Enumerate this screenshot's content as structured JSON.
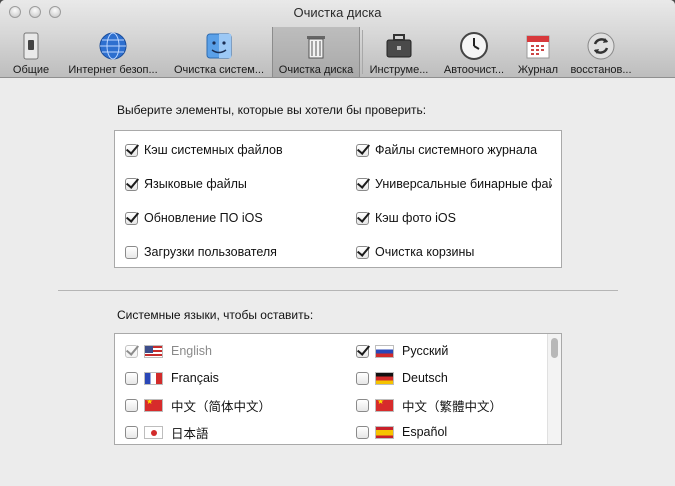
{
  "window": {
    "title": "Очистка диска"
  },
  "toolbar": {
    "items": [
      {
        "label": "Общие",
        "icon": "switch-icon"
      },
      {
        "label": "Интернет безоп...",
        "icon": "globe-icon"
      },
      {
        "label": "Очистка систем...",
        "icon": "finder-icon"
      },
      {
        "label": "Очистка диска",
        "icon": "trash-icon",
        "selected": true
      },
      {
        "label": "Инструме...",
        "icon": "toolbox-icon"
      },
      {
        "label": "Автоочист...",
        "icon": "clock-icon"
      },
      {
        "label": "Журнал",
        "icon": "calendar-icon"
      },
      {
        "label": "восстанов...",
        "icon": "restore-icon"
      }
    ]
  },
  "items_section": {
    "label": "Выберите элементы, которые вы хотели бы проверить:",
    "left": [
      {
        "label": "Кэш системных файлов",
        "checked": true
      },
      {
        "label": "Языковые файлы",
        "checked": true
      },
      {
        "label": "Обновление ПО iOS",
        "checked": true
      },
      {
        "label": "Загрузки пользователя",
        "checked": false
      }
    ],
    "right": [
      {
        "label": "Файлы системного журнала",
        "checked": true
      },
      {
        "label": "Универсальные бинарные фай",
        "checked": true
      },
      {
        "label": "Кэш фото iOS",
        "checked": true
      },
      {
        "label": "Очистка корзины",
        "checked": true
      }
    ]
  },
  "languages_section": {
    "label": "Системные языки, чтобы оставить:",
    "left": [
      {
        "label": "English",
        "checked": true,
        "disabled": true,
        "flag": "us"
      },
      {
        "label": "Français",
        "checked": false,
        "flag": "fr"
      },
      {
        "label": "中文（简体中文）",
        "checked": false,
        "flag": "cn"
      },
      {
        "label": "日本語",
        "checked": false,
        "flag": "jp"
      }
    ],
    "right": [
      {
        "label": "Русский",
        "checked": true,
        "flag": "ru"
      },
      {
        "label": "Deutsch",
        "checked": false,
        "flag": "de"
      },
      {
        "label": "中文（繁體中文）",
        "checked": false,
        "flag": "cn"
      },
      {
        "label": "Español",
        "checked": false,
        "flag": "es"
      }
    ]
  }
}
